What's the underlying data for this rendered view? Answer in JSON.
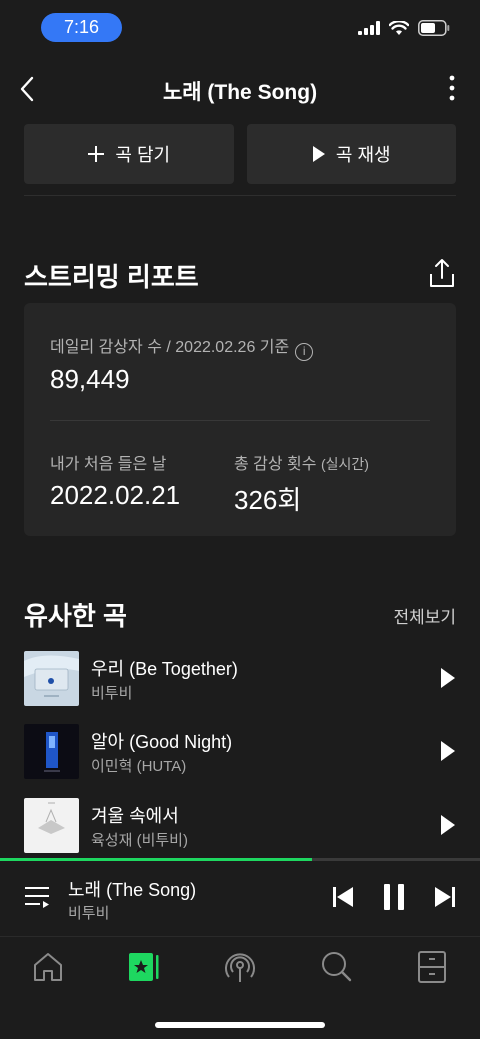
{
  "status_bar": {
    "time": "7:16",
    "icons": [
      "cellular-signal-icon",
      "wifi-icon",
      "battery-icon"
    ]
  },
  "header": {
    "title": "노래 (The Song)",
    "icons": [
      "back-chevron-icon",
      "more-vertical-icon"
    ]
  },
  "actions": {
    "add_label": "곡 담기",
    "play_label": "곡 재생"
  },
  "report": {
    "section_title": "스트리밍 리포트",
    "daily_listeners_label": "데일리 감상자 수 / 2022.02.26 기준",
    "daily_listeners_value": "89,449",
    "first_listen_label": "내가 처음 들은 날",
    "first_listen_value": "2022.02.21",
    "total_plays_label": "총 감상 횟수",
    "total_plays_sub": "(실시간)",
    "total_plays_value": "326회"
  },
  "similar": {
    "section_title": "유사한 곡",
    "see_all": "전체보기",
    "tracks": [
      {
        "title": "우리 (Be Together)",
        "artist": "비투비"
      },
      {
        "title": "알아 (Good Night)",
        "artist": "이민혁 (HUTA)"
      },
      {
        "title": "겨울 속에서",
        "artist": "육성재 (비투비)"
      }
    ]
  },
  "mini_player": {
    "title": "노래 (The Song)",
    "artist": "비투비",
    "progress": 0.65
  },
  "tab_bar": {
    "icons": [
      "home-icon",
      "library-starred-icon",
      "podcast-icon",
      "search-icon",
      "storage-icon"
    ],
    "active_index": 1
  },
  "colors": {
    "background": "#1c1c1c",
    "card": "#262626",
    "accent_green": "#1ed760",
    "time_pill": "#3478f6"
  }
}
